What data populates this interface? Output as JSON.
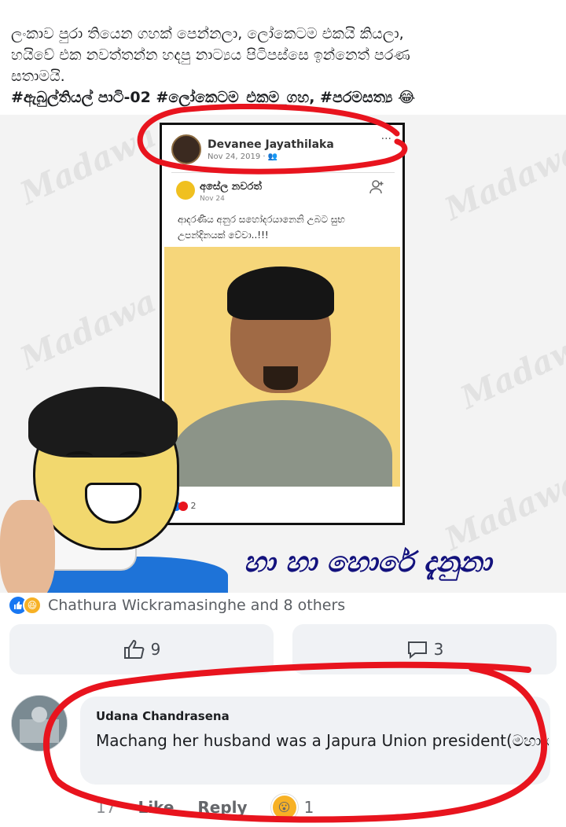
{
  "post": {
    "text_line1": "ලංකාව පුරා තියෙන ගහක් පෙන්නලා, ලෝකෙටම එකයි කියලා,",
    "text_line2": "හයිවේ එක නවත්තන්න හදපු නාට්‍යය පිටිපස්සෙ ඉන්නෙත් පරණ",
    "text_line3": "සතාමයි.",
    "hashtags": "#ඇබුල්තියල් පාටි-02 #ලෝකෙටම_එකම_ගහ, #පරමසත්‍ය",
    "emoji": "😂"
  },
  "meme": {
    "watermark": "Madawa",
    "screenshot": {
      "author": "Devanee Jayathilaka",
      "date": "Nov 24, 2019 · 👥",
      "inner_author": "අසේල නවරත්",
      "inner_date": "Nov 24",
      "message": "ආදරණීය අනුර සහෝදරයානෙනි උබට සුභ උපන්දිනයක් වේවා..!!!",
      "reaction_count": "2"
    },
    "caption": "හා හා හොරේ දැනුනා"
  },
  "reactions": {
    "summary": "Chathura Wickramasinghe and 8 others",
    "like_icon": "like-icon",
    "haha_icon": "haha-icon"
  },
  "actions": {
    "like_count": "9",
    "comment_count": "3"
  },
  "comment": {
    "author": "Udana Chandrasena",
    "text": "Machang her husband was a Japura Union president(මහා ශිෂ්‍ය සංගමය) when we were in Uni",
    "time": "17",
    "like_label": "Like",
    "reply_label": "Reply",
    "reaction_emoji": "😮",
    "reaction_count": "1"
  },
  "colors": {
    "annotation_red": "#e8141e",
    "fb_blue": "#1877f2",
    "caption_blue": "#13127d"
  }
}
